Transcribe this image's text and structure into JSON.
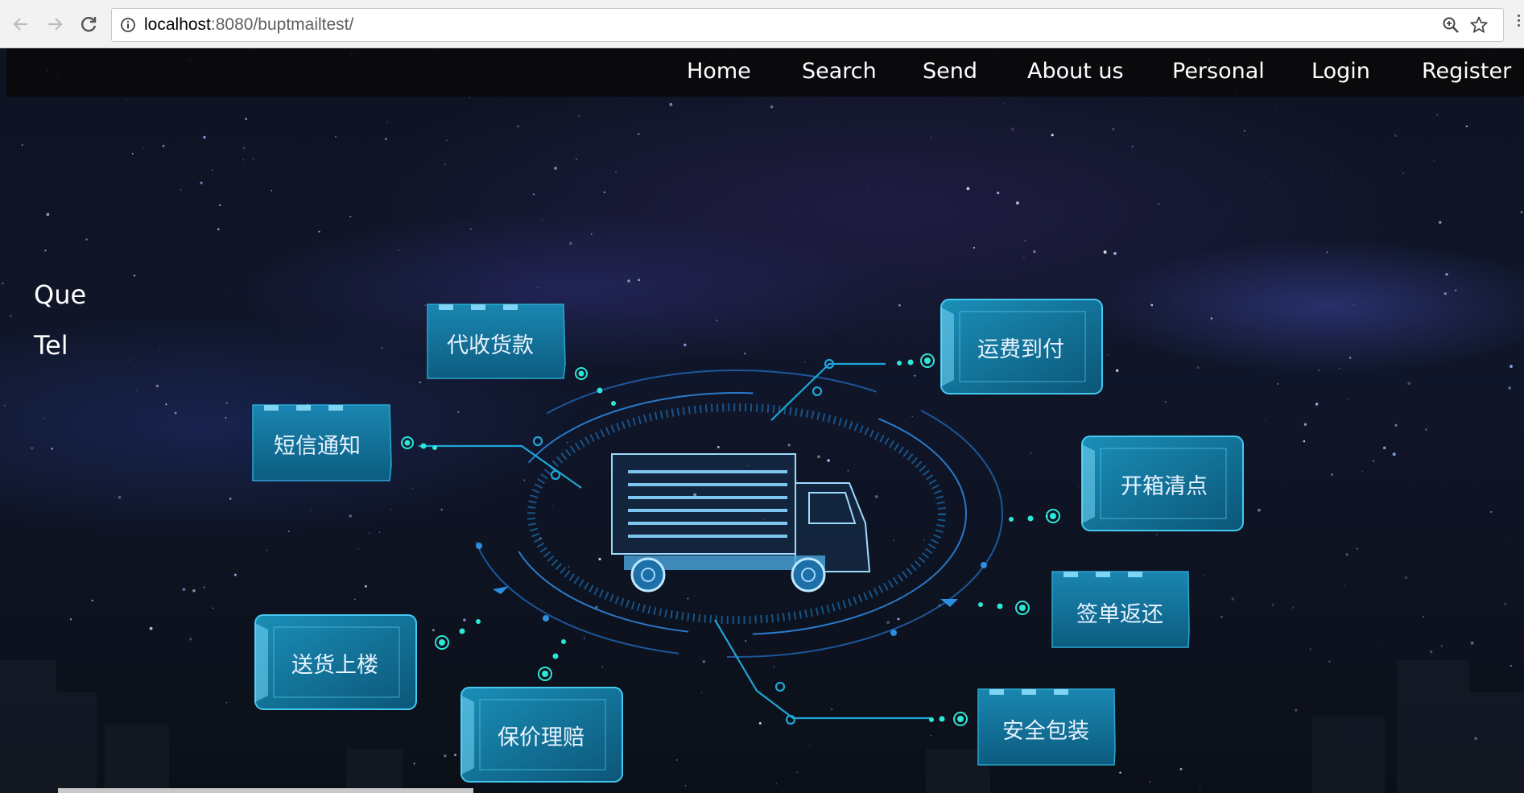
{
  "browser": {
    "host": "localhost",
    "path": ":8080/buptmailtest/"
  },
  "nav": {
    "items": [
      {
        "label": "Home"
      },
      {
        "label": "Search"
      },
      {
        "label": "Send"
      },
      {
        "label": "About us"
      },
      {
        "label": "Personal"
      },
      {
        "label": "Login"
      },
      {
        "label": "Register"
      }
    ]
  },
  "sidebar": {
    "line1": "Que",
    "line2": "Tel"
  },
  "services": {
    "cod": "代收货款",
    "sms": "短信通知",
    "delivery_upstairs": "送货上楼",
    "insured_claim": "保价理赔",
    "freight_collect": "运费到付",
    "unpack_check": "开箱清点",
    "receipt_return": "签单返还",
    "safe_packaging": "安全包装"
  },
  "colors": {
    "accent": "#1ec9e8",
    "badge_fill": "#0f6f95",
    "navbar": "#0a0a0c"
  }
}
